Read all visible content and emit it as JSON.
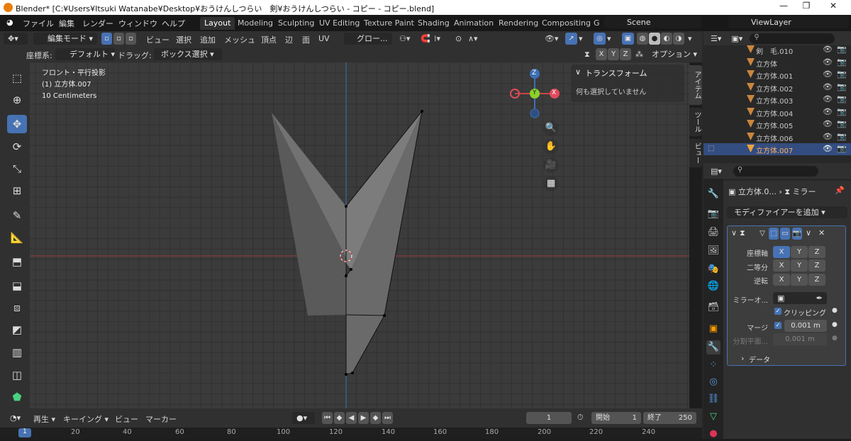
{
  "titlebar": {
    "title": "Blender* [C:¥Users¥Itsuki Watanabe¥Desktop¥おうけんしつらい　剣¥おうけんしつらい - コピー - コピー.blend]"
  },
  "menu": {
    "items": [
      "ファイル",
      "編集",
      "レンダー",
      "ウィンドウ",
      "ヘルプ"
    ]
  },
  "workspaces": {
    "tabs": [
      "Layout",
      "Modeling",
      "Sculpting",
      "UV Editing",
      "Texture Paint",
      "Shading",
      "Animation",
      "Rendering",
      "Compositing",
      "G"
    ],
    "active": "Layout"
  },
  "scene": {
    "label": "Scene",
    "viewlayer": "ViewLayer"
  },
  "header": {
    "mode": "編集モード",
    "items": [
      "ビュー",
      "選択",
      "追加",
      "メッシュ",
      "頂点",
      "辺",
      "面",
      "UV"
    ],
    "transform_orientation": "グロー...",
    "search_placeholder": ""
  },
  "header2": {
    "coord_label": "座標系:",
    "coord_value": "デフォルト",
    "drag_label": "ドラッグ:",
    "drag_value": "ボックス選択",
    "axes": [
      "X",
      "Y",
      "Z"
    ],
    "options": "オプション"
  },
  "viewport": {
    "view_name": "フロント・平行投影",
    "object_name": "(1) 立方体.007",
    "scale": "10 Centimeters"
  },
  "gizmo": {
    "z": "Z",
    "y": "Y",
    "x": "X"
  },
  "npanel": {
    "title": "トランスフォーム",
    "message": "何も選択していません",
    "tabs": [
      "アイテム",
      "ツール",
      "ビュー"
    ]
  },
  "outliner": {
    "rows": [
      {
        "name": "剣　毛.010",
        "selected": false
      },
      {
        "name": "立方体",
        "selected": false
      },
      {
        "name": "立方体.001",
        "selected": false
      },
      {
        "name": "立方体.002",
        "selected": false
      },
      {
        "name": "立方体.003",
        "selected": false
      },
      {
        "name": "立方体.004",
        "selected": false
      },
      {
        "name": "立方体.005",
        "selected": false
      },
      {
        "name": "立方体.006",
        "selected": false
      },
      {
        "name": "立方体.007",
        "selected": true
      }
    ]
  },
  "properties": {
    "breadcrumb_object": "立方体.0...",
    "breadcrumb_modifier": "ミラー",
    "add_modifier": "モディファイアーを追加",
    "axis_label": "座標軸",
    "bisect_label": "二等分",
    "flip_label": "逆転",
    "mirror_obj_label": "ミラーオ...",
    "clipping_label": "クリッピング",
    "merge_label": "マージ",
    "merge_value": "0.001 m",
    "bisect_dist_label": "分割平面...",
    "bisect_dist_value": "0.001 m",
    "data_label": "データ"
  },
  "timeline": {
    "playback": "再生",
    "keying": "キーイング",
    "view": "ビュー",
    "marker": "マーカー",
    "current_frame": "1",
    "start_label": "開始",
    "start": "1",
    "end_label": "終了",
    "end": "250",
    "ruler": [
      "1",
      "20",
      "40",
      "60",
      "80",
      "100",
      "120",
      "140",
      "160",
      "180",
      "200",
      "220",
      "240"
    ]
  }
}
